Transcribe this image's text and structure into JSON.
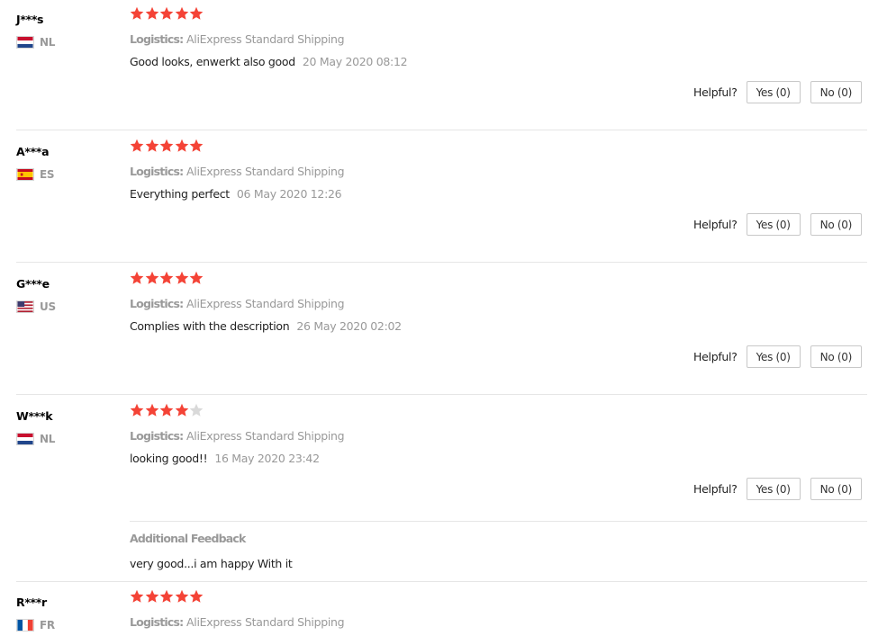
{
  "labels": {
    "logistics_prefix": "Logistics:",
    "helpful": "Helpful?",
    "additional_feedback": "Additional Feedback"
  },
  "colors": {
    "star_filled": "#f44336",
    "star_empty": "#d9d9d9"
  },
  "reviews": [
    {
      "user": "J***s",
      "country": "NL",
      "flag_icon": "netherlands-flag-icon",
      "rating": 5,
      "logistics": "AliExpress Standard Shipping",
      "text": "Good looks, enwerkt also good",
      "date": "20 May 2020 08:12",
      "yes": "Yes (0)",
      "no": "No (0)"
    },
    {
      "user": "A***a",
      "country": "ES",
      "flag_icon": "spain-flag-icon",
      "rating": 5,
      "logistics": "AliExpress Standard Shipping",
      "text": "Everything perfect",
      "date": "06 May 2020 12:26",
      "yes": "Yes (0)",
      "no": "No (0)"
    },
    {
      "user": "G***e",
      "country": "US",
      "flag_icon": "united-states-flag-icon",
      "rating": 5,
      "logistics": "AliExpress Standard Shipping",
      "text": "Complies with the description",
      "date": "26 May 2020 02:02",
      "yes": "Yes (0)",
      "no": "No (0)"
    },
    {
      "user": "W***k",
      "country": "NL",
      "flag_icon": "netherlands-flag-icon",
      "rating": 4,
      "logistics": "AliExpress Standard Shipping",
      "text": "looking good!!",
      "date": "16 May 2020 23:42",
      "yes": "Yes (0)",
      "no": "No (0)",
      "additional_feedback": "very good...i am happy With it"
    },
    {
      "user": "R***r",
      "country": "FR",
      "flag_icon": "france-flag-icon",
      "rating": 5,
      "logistics": "AliExpress Standard Shipping"
    }
  ]
}
